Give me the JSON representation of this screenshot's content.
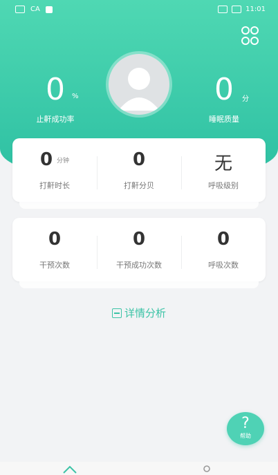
{
  "status_bar": {
    "left_text": "CA",
    "time": "11:01"
  },
  "header": {
    "left_stat": {
      "value": "0",
      "unit": "%",
      "label": "止鼾成功率"
    },
    "right_stat": {
      "value": "0",
      "unit": "分",
      "label": "睡眠质量"
    },
    "menu_icon": "grid-icon",
    "avatar_icon": "user-avatar-icon"
  },
  "card1": [
    {
      "value": "0",
      "unit": "分钟",
      "label": "打鼾时长"
    },
    {
      "value": "0",
      "unit": "",
      "label": "打鼾分贝"
    },
    {
      "value": "无",
      "unit": "",
      "label": "呼吸级别"
    }
  ],
  "card2": [
    {
      "value": "0",
      "label": "干预次数"
    },
    {
      "value": "0",
      "label": "干预成功次数"
    },
    {
      "value": "0",
      "label": "呼吸次数"
    }
  ],
  "detail_link": {
    "label": "详情分析",
    "icon": "report-icon"
  },
  "help_button": {
    "symbol": "?",
    "label": "帮助"
  },
  "tabs": [
    {
      "icon": "home-icon"
    },
    {
      "icon": "profile-icon"
    }
  ],
  "colors": {
    "accent": "#2fc1a3",
    "accent_light": "#4fd8b3",
    "background": "#f2f3f5"
  }
}
